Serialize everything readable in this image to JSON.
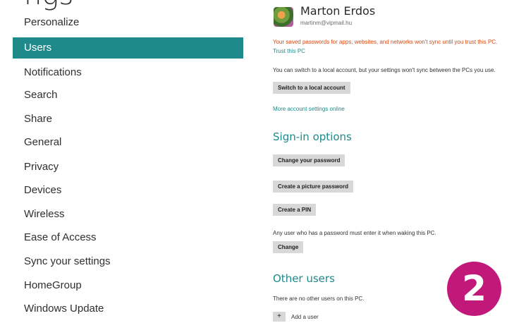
{
  "sidebar": {
    "partial_title": "ngs",
    "items": [
      {
        "label": "Personalize"
      },
      {
        "label": "Users"
      },
      {
        "label": "Notifications"
      },
      {
        "label": "Search"
      },
      {
        "label": "Share"
      },
      {
        "label": "General"
      },
      {
        "label": "Privacy"
      },
      {
        "label": "Devices"
      },
      {
        "label": "Wireless"
      },
      {
        "label": "Ease of Access"
      },
      {
        "label": "Sync your settings"
      },
      {
        "label": "HomeGroup"
      },
      {
        "label": "Windows Update"
      }
    ],
    "active_index": 1
  },
  "account": {
    "name": "Marton Erdos",
    "email": "martinm@vipmail.hu",
    "warning": "Your saved passwords for apps, websites, and networks won't sync until you trust this PC.",
    "trust_link": "Trust this PC",
    "switch_desc": "You can switch to a local account, but your settings won't sync between the PCs you use.",
    "switch_button": "Switch to a local account",
    "more_link": "More account settings online"
  },
  "signin": {
    "header": "Sign-in options",
    "change_password": "Change your password",
    "picture_password": "Create a picture password",
    "create_pin": "Create a PIN",
    "password_desc": "Any user who has a password must enter it when waking this PC.",
    "change_button": "Change"
  },
  "other_users": {
    "header": "Other users",
    "none_text": "There are no other users on this PC.",
    "add_label": "Add a user"
  },
  "badge": {
    "text": "2"
  },
  "colors": {
    "accent": "#1f8a8a",
    "warning": "#d9480f",
    "badge": "#c2187a"
  }
}
